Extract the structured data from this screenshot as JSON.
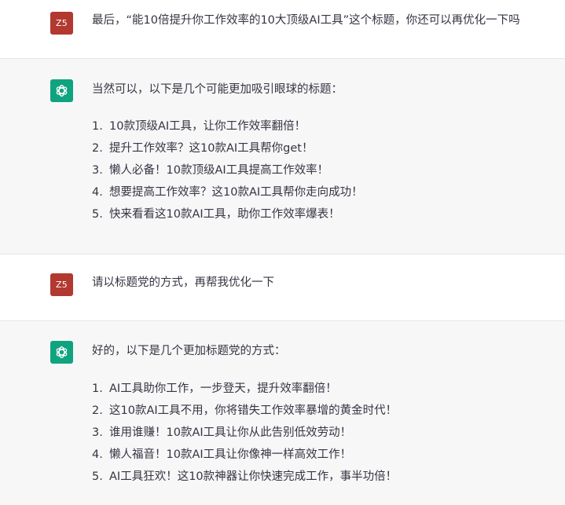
{
  "conversation": [
    {
      "role": "user",
      "avatar_text": "Z5",
      "text": "最后，“能10倍提升你工作效率的10大顶级AI工具”这个标题，你还可以再优化一下吗"
    },
    {
      "role": "assistant",
      "avatar_icon": "openai-logo-icon",
      "intro": "当然可以，以下是几个可能更加吸引眼球的标题：",
      "items": [
        {
          "num": "1.",
          "text": "10款顶级AI工具，让你工作效率翻倍！"
        },
        {
          "num": "2.",
          "text": "提升工作效率？这10款AI工具帮你get！"
        },
        {
          "num": "3.",
          "text": "懒人必备！10款顶级AI工具提高工作效率！"
        },
        {
          "num": "4.",
          "text": "想要提高工作效率？这10款AI工具帮你走向成功！"
        },
        {
          "num": "5.",
          "text": "快来看看这10款AI工具，助你工作效率爆表！"
        }
      ]
    },
    {
      "role": "user",
      "avatar_text": "Z5",
      "text": "请以标题党的方式，再帮我优化一下"
    },
    {
      "role": "assistant",
      "avatar_icon": "openai-logo-icon",
      "intro": "好的，以下是几个更加标题党的方式：",
      "items": [
        {
          "num": "1.",
          "text": "AI工具助你工作，一步登天，提升效率翻倍！"
        },
        {
          "num": "2.",
          "text": "这10款AI工具不用，你将错失工作效率暴增的黄金时代！"
        },
        {
          "num": "3.",
          "text": "谁用谁赚！10款AI工具让你从此告别低效劳动！"
        },
        {
          "num": "4.",
          "text": "懒人福音！10款AI工具让你像神一样高效工作！"
        },
        {
          "num": "5.",
          "text": "AI工具狂欢！这10款神器让你快速完成工作，事半功倍！"
        }
      ]
    }
  ],
  "colors": {
    "user_avatar_bg": "#b2392f",
    "assistant_avatar_bg": "#10a37f",
    "assistant_row_bg": "#f7f7f8",
    "text": "#343541"
  }
}
